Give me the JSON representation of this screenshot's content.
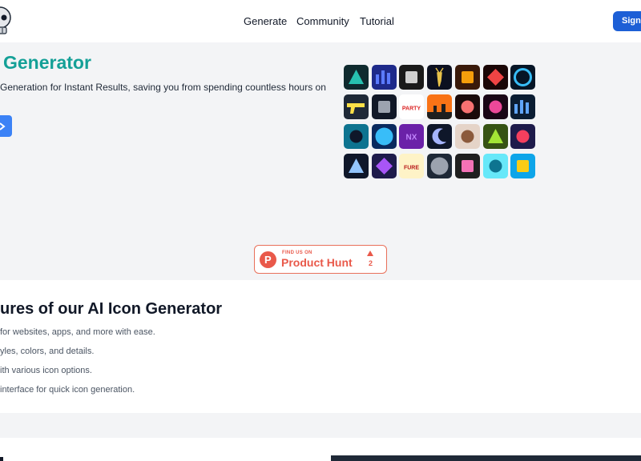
{
  "header": {
    "nav": [
      "Generate",
      "Community",
      "Tutorial"
    ],
    "signin_label": "Sign i",
    "logo_icon": "skull-icon"
  },
  "hero": {
    "title": "Generator",
    "subtitle": "Generation for Instant Results, saving you from spending countless hours on",
    "cta_icon": "arrow-right-icon",
    "accent_color": "#14a097"
  },
  "product_hunt": {
    "small_text": "FIND US ON",
    "name": "Product Hunt",
    "count": "2"
  },
  "icon_tiles": [
    {
      "name": "tile-geometric-teal",
      "text": ""
    },
    {
      "name": "tile-city-blue",
      "text": ""
    },
    {
      "name": "tile-box-grey",
      "text": ""
    },
    {
      "name": "tile-deer",
      "text": ""
    },
    {
      "name": "tile-book-orange",
      "text": ""
    },
    {
      "name": "tile-cards-red",
      "text": ""
    },
    {
      "name": "tile-eye-blue",
      "text": ""
    },
    {
      "name": "tile-gun",
      "text": ""
    },
    {
      "name": "tile-dice",
      "text": ""
    },
    {
      "name": "tile-party",
      "text": "PARTY"
    },
    {
      "name": "tile-sunset",
      "text": ""
    },
    {
      "name": "tile-face-red",
      "text": ""
    },
    {
      "name": "tile-girl-pink",
      "text": ""
    },
    {
      "name": "tile-robot-blue",
      "text": ""
    },
    {
      "name": "tile-alien-teal",
      "text": ""
    },
    {
      "name": "tile-orb-blue",
      "text": ""
    },
    {
      "name": "tile-nx",
      "text": "NX"
    },
    {
      "name": "tile-moon",
      "text": ""
    },
    {
      "name": "tile-baby",
      "text": ""
    },
    {
      "name": "tile-monster-green",
      "text": ""
    },
    {
      "name": "tile-monster-pink",
      "text": ""
    },
    {
      "name": "tile-knight",
      "text": ""
    },
    {
      "name": "tile-flower-purple",
      "text": ""
    },
    {
      "name": "tile-fure",
      "text": "FURE"
    },
    {
      "name": "tile-ghost-grey",
      "text": ""
    },
    {
      "name": "tile-letter-f",
      "text": ""
    },
    {
      "name": "tile-smile-cyan",
      "text": ""
    },
    {
      "name": "tile-sponge",
      "text": ""
    }
  ],
  "features": {
    "title": "ures of our AI Icon Generator",
    "items": [
      "for websites, apps, and more with ease.",
      "yles, colors, and details.",
      "ith various icon options.",
      "interface for quick icon generation."
    ]
  }
}
